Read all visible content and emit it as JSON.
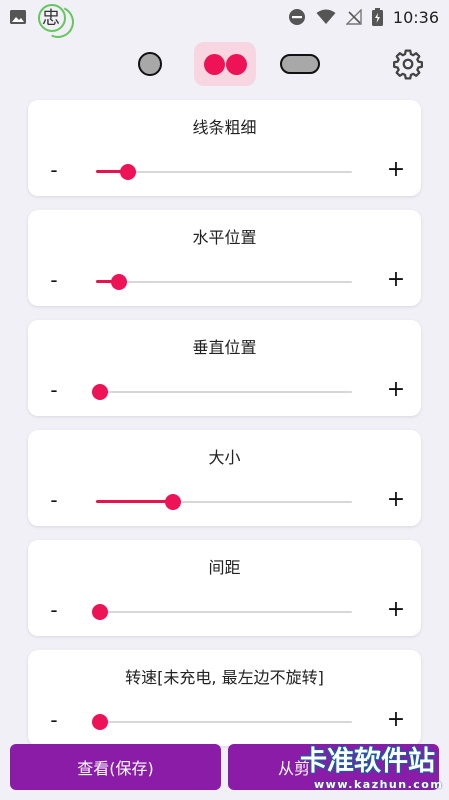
{
  "status_bar": {
    "time": "10:36",
    "badge_label": "忠"
  },
  "toolbar": {
    "shapes": [
      {
        "name": "circle",
        "selected": false
      },
      {
        "name": "double-dot",
        "selected": true
      },
      {
        "name": "pill",
        "selected": false
      }
    ],
    "settings_icon": "gear-icon"
  },
  "cards": [
    {
      "title": "线条粗细",
      "minus": "-",
      "plus": "+",
      "value": 0.11
    },
    {
      "title": "水平位置",
      "minus": "-",
      "plus": "+",
      "value": 0.075
    },
    {
      "title": "垂直位置",
      "minus": "-",
      "plus": "+",
      "value": 0.0
    },
    {
      "title": "大小",
      "minus": "-",
      "plus": "+",
      "value": 0.29
    },
    {
      "title": "间距",
      "minus": "-",
      "plus": "+",
      "value": 0.0
    },
    {
      "title": "转速[未充电, 最左边不旋转]",
      "minus": "-",
      "plus": "+",
      "value": 0.0
    }
  ],
  "bottom": {
    "view_button": "查看(保存)",
    "second_button": "从剪"
  },
  "watermark": {
    "main": "卡准软件站",
    "sub": "www.kazhun.com"
  },
  "colors": {
    "accent": "#ee1256",
    "button": "#8a1ca8",
    "background": "#f1f0f6"
  }
}
